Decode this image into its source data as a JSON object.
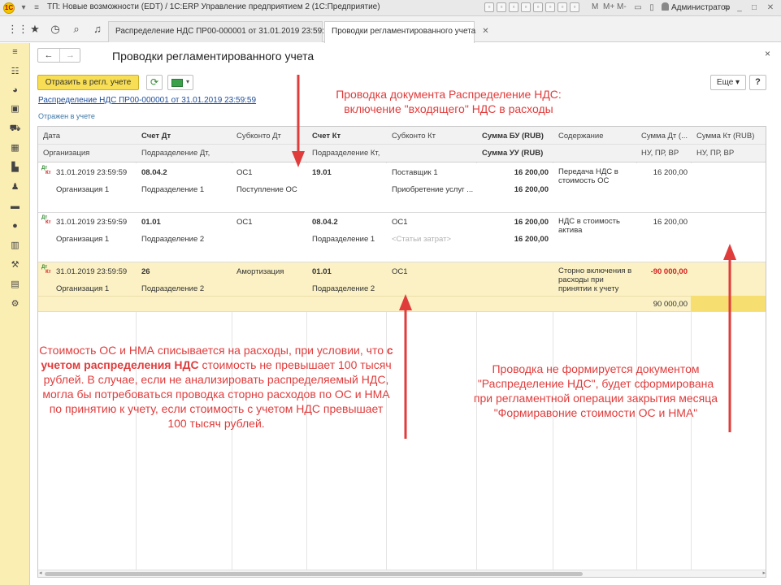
{
  "window": {
    "title": "ТП: Новые возможности (EDT) / 1С:ERP Управление предприятием 2  (1С:Предприятие)",
    "logo": "1С",
    "m_labels": [
      "M",
      "M+",
      "M-"
    ],
    "user": "Администратор",
    "controls": {
      "minimize": "_",
      "restore": "□",
      "close": "✕"
    }
  },
  "tabs": [
    {
      "label": "Распределение НДС ПР00-000001 от 31.01.2019 23:59:59",
      "active": false
    },
    {
      "label": "Проводки регламентированного учета",
      "active": true
    }
  ],
  "form": {
    "title": "Проводки регламентированного учета",
    "close": "×",
    "nav_back": "←",
    "nav_forward": "→",
    "post_button": "Отразить в регл. учете",
    "refresh_icon": "⟳",
    "more_button": "Еще ▾",
    "help_button": "?",
    "document_link": "Распределение НДС ПР00-000001 от 31.01.2019 23:59:59",
    "posted_status": "Отражен в учете"
  },
  "table": {
    "headers_top": [
      "Дата",
      "Счет Дт",
      "Субконто Дт",
      "Счет Кт",
      "Субконто Кт",
      "Сумма БУ (RUB)",
      "Содержание",
      "Сумма Дт (...",
      "Сумма Кт (RUB)"
    ],
    "headers_bottom": [
      "Организация",
      "Подразделение Дт,",
      "",
      "Подразделение Кт,",
      "",
      "Сумма УУ (RUB)",
      "",
      "НУ, ПР, ВР",
      "НУ, ПР, ВР"
    ],
    "dt_label": "Дт",
    "kt_label": "Кт",
    "rows": [
      {
        "date": "31.01.2019 23:59:59",
        "org": "Организация 1",
        "debit_account": "08.04.2",
        "debit_dept": "Подразделение 1",
        "debit_sub1": "ОС1",
        "debit_sub2": "Поступление ОС",
        "credit_account": "19.01",
        "credit_dept": "",
        "credit_sub1": "Поставщик 1",
        "credit_sub2": "Приобретение услуг ...",
        "sum_bu": "16 200,00",
        "sum_uu": "16 200,00",
        "content": "Передача НДС в стоимость ОС",
        "sum_dt_nu": "16 200,00",
        "sum_kt_nu": ""
      },
      {
        "date": "31.01.2019 23:59:59",
        "org": "Организация 1",
        "debit_account": "01.01",
        "debit_dept": "Подразделение 2",
        "debit_sub1": "ОС1",
        "debit_sub2": "",
        "credit_account": "08.04.2",
        "credit_dept": "Подразделение 1",
        "credit_sub1": "ОС1",
        "credit_sub2": "<Статьи затрат>",
        "sum_bu": "16 200,00",
        "sum_uu": "16 200,00",
        "content": "НДС в стоимость актива",
        "sum_dt_nu": "16 200,00",
        "sum_kt_nu": ""
      },
      {
        "date": "31.01.2019 23:59:59",
        "org": "Организация 1",
        "debit_account": "26",
        "debit_dept": "Подразделение 2",
        "debit_sub1": "Амортизация",
        "debit_sub2": "",
        "credit_account": "01.01",
        "credit_dept": "Подразделение 2",
        "credit_sub1": "ОС1",
        "credit_sub2": "",
        "sum_bu": "",
        "sum_uu": "",
        "content": "Сторно включения в расходы при принятии к учету",
        "sum_dt_nu": "-90 000,00",
        "sum_dt_nu_2": "90 000,00",
        "sum_kt_nu": ""
      }
    ]
  },
  "annotations": {
    "top": [
      "Проводка документа Распределение НДС:",
      "включение \"входящего\" НДС в расходы"
    ],
    "left_part1": "Стоимость ОС и НМА списывается на расходы, при условии, что ",
    "left_bold": "с учетом распределения НДС",
    "left_part2": " стоимость не превышает 100 тысяч рублей. В случае, если не анализировать распределяемый НДС, могла бы потребоваться проводка сторно расходов по ОС и НМА по принятию к учету, если стоимость с учетом НДС превышает 100 тысяч рублей.",
    "right": "Проводка не формируется документом \"Распределение НДС\", будет сформирована при регламентной операции закрытия месяца \"Формиравоние стоимости ОС и НМА\""
  },
  "colors": {
    "accent_yellow": "#f7de54",
    "sidebar": "#fbeeb3",
    "annotation_red": "#e03c3c",
    "selected_row": "#fbf1c4"
  }
}
